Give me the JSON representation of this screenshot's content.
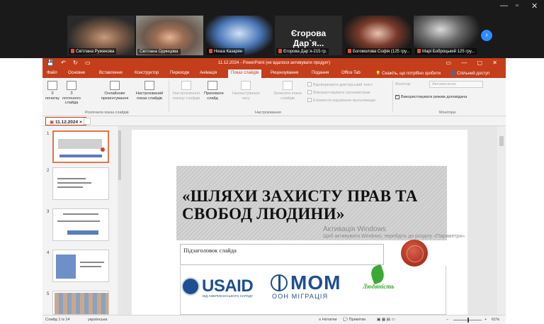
{
  "zoom": {
    "participants": [
      {
        "name": "Світлана Руженова"
      },
      {
        "name": "Світлана Одинцова"
      },
      {
        "name": "Неша Казарян"
      },
      {
        "name": "Єгорова Дар`я-215 гр."
      },
      {
        "name": "Богомолова Софія (125 гру..."
      },
      {
        "name": "Марі Боброцький 125 гру..."
      }
    ],
    "big_name": "Єгорова Дар`я..."
  },
  "ppt": {
    "title": "11.12.2024 - PowerPoint (не вдалося активувати продукт)",
    "tabs": [
      "Файл",
      "Основне",
      "Вставлення",
      "Конструктор",
      "Переходи",
      "Анімація",
      "Показ слайдів",
      "Рецензування",
      "Подання",
      "Office Tab"
    ],
    "active_tab": "Показ слайдів",
    "tell_me": "Скажіть, що потрібно зробити",
    "share": "Спільний доступ",
    "ribbon": {
      "from_start": "З початку",
      "from_current": "З поточного слайда",
      "online": "Онлайнове презентування",
      "custom": "Настроюваний показ слайдів",
      "group1": "Розпочати показ слайдів",
      "setup": "Настроювання показу слайдів",
      "hide": "Приховати слайд",
      "rehearse": "Налаштування часу",
      "record": "Записати показ слайдів",
      "chk_narr": "Відтворювати дикторський текст",
      "chk_timing": "Використовувати хронометраж",
      "chk_media": "Елементи керування мультимедіа",
      "group2": "Настроювання",
      "monitor_label": "Монітор:",
      "monitor_value": "Автоматично",
      "presenter": "Використовувати режим доповідача",
      "group3": "Монітори"
    },
    "doc_tab": "11.12.2024",
    "slides": [
      "1",
      "2",
      "3",
      "4",
      "5"
    ],
    "slide": {
      "title": "«ШЛЯХИ ЗАХИСТУ ПРАВ ТА СВОБОД ЛЮДИНИ»",
      "subtitle": "Підзаголовок слайда",
      "usaid_word": "USAID",
      "usaid_sub": "ВІД АМЕРИКАНСЬКОГО НАРОДУ",
      "mom": "МОМ",
      "mom_sub": "ООН МІГРАЦІЯ",
      "lyud": "Людяність"
    },
    "watermark": "Активація Windows",
    "watermark_sub": "Щоб активувати Windows, перейдіть до розділу «Параметри».",
    "status": {
      "slide": "Слайд 1 із 14",
      "lang": "українська",
      "notes": "Нотатки",
      "comments": "Примітки",
      "zoom": "61%"
    }
  }
}
